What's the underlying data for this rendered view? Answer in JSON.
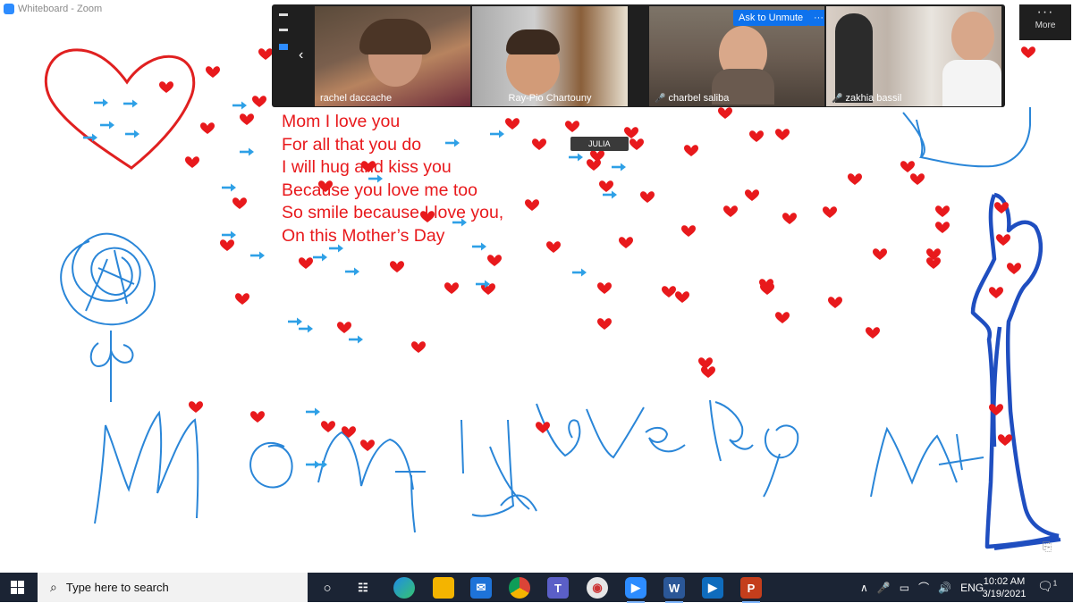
{
  "window": {
    "title": "Whiteboard - Zoom"
  },
  "poem": {
    "lines": [
      "Mom I love you",
      "For all that you do",
      "I will hug and kiss you",
      "Because you love me too",
      "So smile because I love you,",
      "On this Mother’s Day"
    ]
  },
  "gallery": {
    "participants": [
      {
        "name": "rachel daccache",
        "muted": false
      },
      {
        "name": "Ray-Pio Chartouny",
        "muted": false
      },
      {
        "name": "charbel saliba",
        "muted": true
      },
      {
        "name": "zakhia bassil",
        "muted": true
      }
    ],
    "ask_to_unmute": "Ask to Unmute",
    "ask_more": "···",
    "more_label": "More"
  },
  "annotation_label": "JULIA",
  "taskbar": {
    "search_placeholder": "Type here to search",
    "language": "ENG",
    "time": "10:02 AM",
    "date": "3/19/2021",
    "notification_count": "1"
  },
  "colors": {
    "heart": "#e8191c",
    "arrow": "#2ea0e6",
    "sketch_blue": "#2a86d8",
    "dark_blue": "#1f4ec0",
    "zoom_blue": "#0e72ed",
    "taskbar": "#1b2434"
  },
  "icons": [
    "zoom-logo-icon",
    "windows-start-icon",
    "search-icon",
    "cortana-icon",
    "task-view-icon",
    "edge-icon",
    "file-explorer-icon",
    "mail-icon",
    "chrome-icon",
    "teams-icon",
    "paint-icon",
    "zoom-icon",
    "word-icon",
    "movies-icon",
    "powerpoint-icon",
    "chevron-up-icon",
    "microphone-icon",
    "battery-icon",
    "wifi-icon",
    "speaker-icon",
    "notification-icon"
  ]
}
